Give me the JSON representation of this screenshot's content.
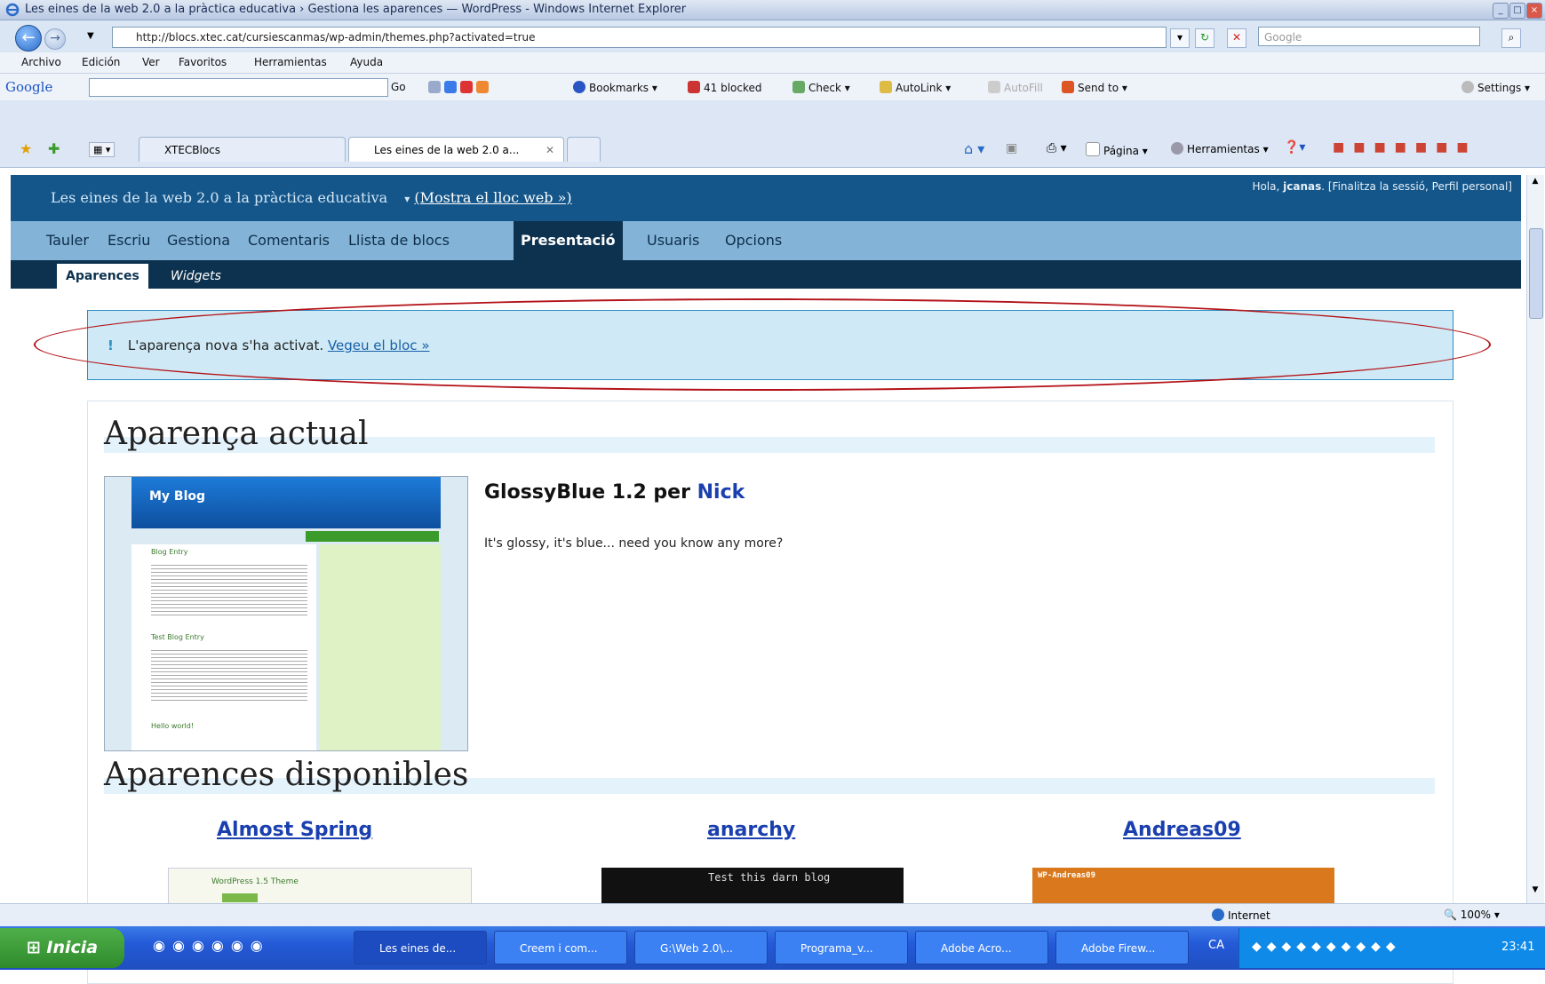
{
  "window": {
    "title": "Les eines de la web 2.0 a la pràctica educativa › Gestiona les aparences — WordPress - Windows Internet Explorer"
  },
  "browser": {
    "url": "http://blocs.xtec.cat/cursiescanmas/wp-admin/themes.php?activated=true",
    "search_placeholder": "Google",
    "menu": [
      "Archivo",
      "Edición",
      "Ver",
      "Favoritos",
      "Herramientas",
      "Ayuda"
    ],
    "google_toolbar": {
      "logo": "Google",
      "go": "Go",
      "bookmarks": "Bookmarks",
      "blocked": "41 blocked",
      "check": "Check",
      "autolink": "AutoLink",
      "autofill": "AutoFill",
      "sendto": "Send to",
      "settings": "Settings"
    },
    "tabs": [
      {
        "label": "XTECBlocs"
      },
      {
        "label": "Les eines de la web 2.0 a..."
      }
    ],
    "command_bar": {
      "page": "Página",
      "tools": "Herramientas"
    }
  },
  "wp": {
    "site_title": "Les eines de la web 2.0 a la pràctica educativa",
    "view_site": "(Mostra el lloc web »)",
    "greeting": "Hola, ",
    "username": "jcanas",
    "user_links": ". [Finalitza la sessió, Perfil personal]",
    "menu": [
      "Tauler",
      "Escriu",
      "Gestiona",
      "Comentaris",
      "Llista de blocs",
      "Presentació",
      "Usuaris",
      "Opcions"
    ],
    "active_menu": "Presentació",
    "submenu": {
      "current": "Aparences",
      "other": "Widgets"
    },
    "notice": {
      "text": "L'aparença nova s'ha activat. ",
      "link": "Vegeu el bloc »"
    },
    "current_heading": "Aparença actual",
    "current_theme": {
      "name": "GlossyBlue 1.2 per ",
      "author": "Nick",
      "description": "It's glossy, it's blue... need you know any more?"
    },
    "preview": {
      "blog_title": "My Blog",
      "entries": [
        "Blog Entry",
        "Test Blog Entry",
        "Hello world!"
      ]
    },
    "available_heading": "Aparences disponibles",
    "available": [
      "Almost Spring",
      "anarchy",
      "Andreas09"
    ],
    "thumbnail_texts": [
      "WordPress 1.5 Theme",
      "Test this darn blog",
      "WP-Andreas09"
    ]
  },
  "statusbar": {
    "zone": "Internet",
    "zoom": "100%"
  },
  "taskbar": {
    "start": "Inicia",
    "tasks": [
      "Les eines de...",
      "Creem i com...",
      "G:\\Web 2.0\\...",
      "Programa_v...",
      "Adobe Acro...",
      "Adobe Firew..."
    ],
    "lang": "CA",
    "clock": "23:41"
  }
}
